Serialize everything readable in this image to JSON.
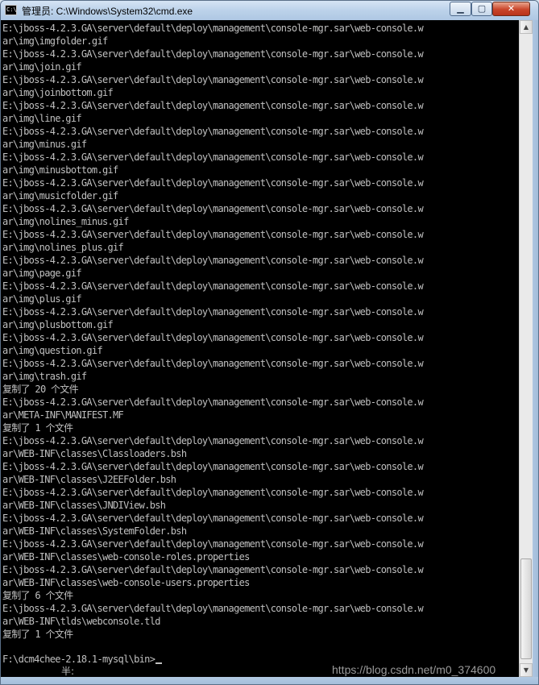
{
  "window": {
    "title": "管理员: C:\\Windows\\System32\\cmd.exe",
    "icon_text": "C:\\",
    "controls": {
      "minimize": "▁",
      "maximize": "▢",
      "close": "✕"
    }
  },
  "console": {
    "lines": [
      "E:\\jboss-4.2.3.GA\\server\\default\\deploy\\management\\console-mgr.sar\\web-console.w",
      "ar\\img\\imgfolder.gif",
      "E:\\jboss-4.2.3.GA\\server\\default\\deploy\\management\\console-mgr.sar\\web-console.w",
      "ar\\img\\join.gif",
      "E:\\jboss-4.2.3.GA\\server\\default\\deploy\\management\\console-mgr.sar\\web-console.w",
      "ar\\img\\joinbottom.gif",
      "E:\\jboss-4.2.3.GA\\server\\default\\deploy\\management\\console-mgr.sar\\web-console.w",
      "ar\\img\\line.gif",
      "E:\\jboss-4.2.3.GA\\server\\default\\deploy\\management\\console-mgr.sar\\web-console.w",
      "ar\\img\\minus.gif",
      "E:\\jboss-4.2.3.GA\\server\\default\\deploy\\management\\console-mgr.sar\\web-console.w",
      "ar\\img\\minusbottom.gif",
      "E:\\jboss-4.2.3.GA\\server\\default\\deploy\\management\\console-mgr.sar\\web-console.w",
      "ar\\img\\musicfolder.gif",
      "E:\\jboss-4.2.3.GA\\server\\default\\deploy\\management\\console-mgr.sar\\web-console.w",
      "ar\\img\\nolines_minus.gif",
      "E:\\jboss-4.2.3.GA\\server\\default\\deploy\\management\\console-mgr.sar\\web-console.w",
      "ar\\img\\nolines_plus.gif",
      "E:\\jboss-4.2.3.GA\\server\\default\\deploy\\management\\console-mgr.sar\\web-console.w",
      "ar\\img\\page.gif",
      "E:\\jboss-4.2.3.GA\\server\\default\\deploy\\management\\console-mgr.sar\\web-console.w",
      "ar\\img\\plus.gif",
      "E:\\jboss-4.2.3.GA\\server\\default\\deploy\\management\\console-mgr.sar\\web-console.w",
      "ar\\img\\plusbottom.gif",
      "E:\\jboss-4.2.3.GA\\server\\default\\deploy\\management\\console-mgr.sar\\web-console.w",
      "ar\\img\\question.gif",
      "E:\\jboss-4.2.3.GA\\server\\default\\deploy\\management\\console-mgr.sar\\web-console.w",
      "ar\\img\\trash.gif",
      "复制了 20 个文件",
      "E:\\jboss-4.2.3.GA\\server\\default\\deploy\\management\\console-mgr.sar\\web-console.w",
      "ar\\META-INF\\MANIFEST.MF",
      "复制了 1 个文件",
      "E:\\jboss-4.2.3.GA\\server\\default\\deploy\\management\\console-mgr.sar\\web-console.w",
      "ar\\WEB-INF\\classes\\Classloaders.bsh",
      "E:\\jboss-4.2.3.GA\\server\\default\\deploy\\management\\console-mgr.sar\\web-console.w",
      "ar\\WEB-INF\\classes\\J2EEFolder.bsh",
      "E:\\jboss-4.2.3.GA\\server\\default\\deploy\\management\\console-mgr.sar\\web-console.w",
      "ar\\WEB-INF\\classes\\JNDIView.bsh",
      "E:\\jboss-4.2.3.GA\\server\\default\\deploy\\management\\console-mgr.sar\\web-console.w",
      "ar\\WEB-INF\\classes\\SystemFolder.bsh",
      "E:\\jboss-4.2.3.GA\\server\\default\\deploy\\management\\console-mgr.sar\\web-console.w",
      "ar\\WEB-INF\\classes\\web-console-roles.properties",
      "E:\\jboss-4.2.3.GA\\server\\default\\deploy\\management\\console-mgr.sar\\web-console.w",
      "ar\\WEB-INF\\classes\\web-console-users.properties",
      "复制了 6 个文件",
      "E:\\jboss-4.2.3.GA\\server\\default\\deploy\\management\\console-mgr.sar\\web-console.w",
      "ar\\WEB-INF\\tlds\\webconsole.tld",
      "复制了 1 个文件"
    ],
    "prompt": "F:\\dcm4chee-2.18.1-mysql\\bin>",
    "ime_status": "半:",
    "watermark": "https://blog.csdn.net/m0_374600"
  },
  "scrollbar": {
    "up_arrow": "▲",
    "down_arrow": "▼"
  }
}
